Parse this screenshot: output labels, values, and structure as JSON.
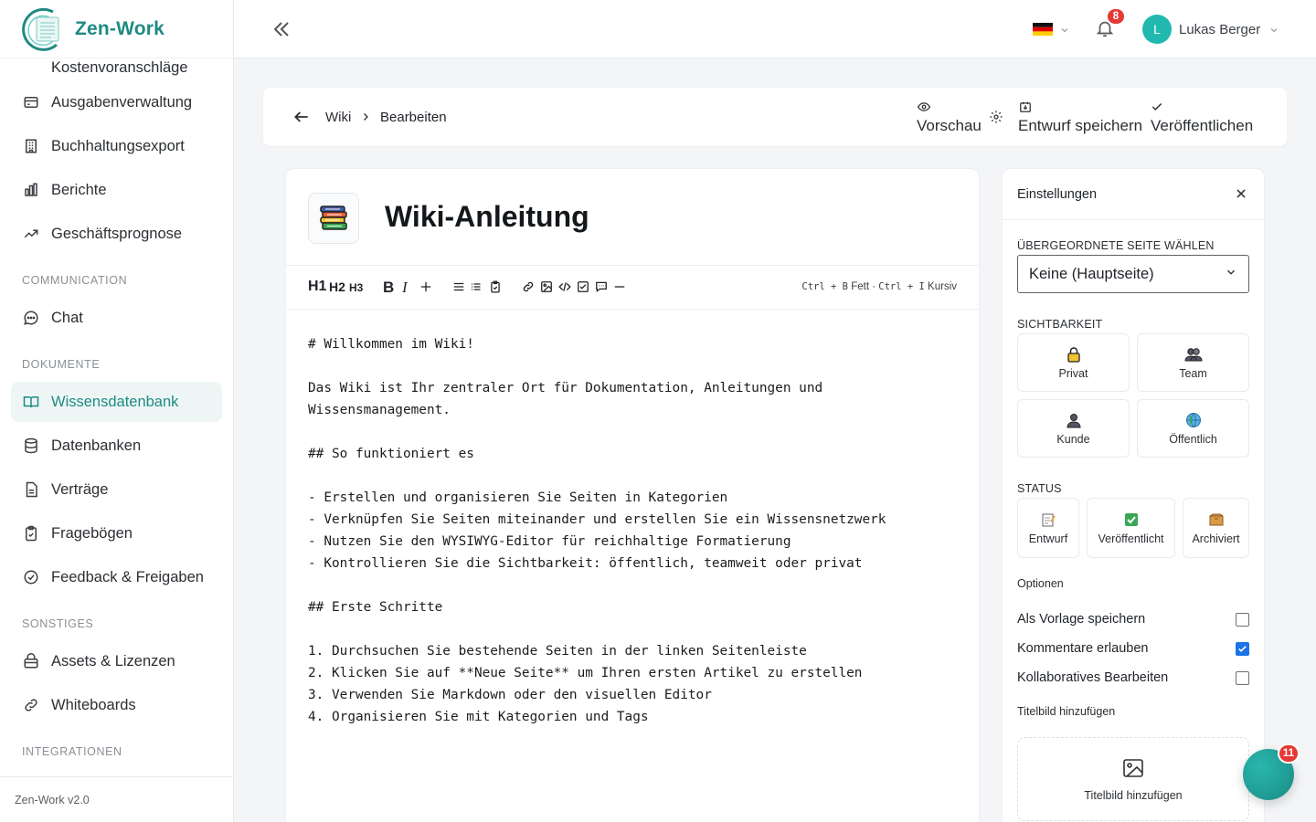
{
  "app": {
    "name": "Zen-Work",
    "version": "Zen-Work v2.0",
    "accent": "#1f8a83"
  },
  "sidebar": {
    "items": [
      {
        "label": "Kostenvoranschläge",
        "icon": "quote-icon"
      },
      {
        "label": "Ausgabenverwaltung",
        "icon": "wallet-icon"
      },
      {
        "label": "Buchhaltungsexport",
        "icon": "building-icon"
      },
      {
        "label": "Berichte",
        "icon": "bar-chart-icon"
      },
      {
        "label": "Geschäftsprognose",
        "icon": "trend-icon"
      }
    ],
    "sections": {
      "communication": "COMMUNICATION",
      "dokumente": "DOKUMENTE",
      "sonstiges": "SONSTIGES",
      "integrationen": "INTEGRATIONEN"
    },
    "communication_items": [
      {
        "label": "Chat",
        "icon": "chat-icon"
      }
    ],
    "dokumente_items": [
      {
        "label": "Wissensdatenbank",
        "icon": "book-icon",
        "active": true
      },
      {
        "label": "Datenbanken",
        "icon": "database-icon"
      },
      {
        "label": "Verträge",
        "icon": "document-icon"
      },
      {
        "label": "Fragebögen",
        "icon": "clipboard-icon"
      },
      {
        "label": "Feedback & Freigaben",
        "icon": "check-circle-icon"
      }
    ],
    "sonstiges_items": [
      {
        "label": "Assets & Lizenzen",
        "icon": "package-icon"
      },
      {
        "label": "Whiteboards",
        "icon": "link-icon"
      }
    ]
  },
  "topbar": {
    "language_flag": "de-flag-icon",
    "notifications_count": "8",
    "user_initial": "L",
    "user_name": "Lukas Berger"
  },
  "editbar": {
    "breadcrumb_root": "Wiki",
    "breadcrumb_current": "Bearbeiten",
    "preview_label": "Vorschau",
    "save_draft_label": "Entwurf speichern",
    "publish_label": "Veröffentlichen"
  },
  "editor": {
    "title": "Wiki-Anleitung",
    "toolbar": {
      "h1": "H1",
      "h2": "H2",
      "h3": "H3",
      "bold": "B",
      "italic": "I",
      "hint_bold_key": "Ctrl + B",
      "hint_bold": "Fett",
      "hint_italic_key": "Ctrl + I",
      "hint_italic": "Kursiv"
    },
    "content": "# Willkommen im Wiki!\n\nDas Wiki ist Ihr zentraler Ort für Dokumentation, Anleitungen und\nWissensmanagement.\n\n## So funktioniert es\n\n- Erstellen und organisieren Sie Seiten in Kategorien\n- Verknüpfen Sie Seiten miteinander und erstellen Sie ein Wissensnetzwerk\n- Nutzen Sie den WYSIWYG-Editor für reichhaltige Formatierung\n- Kontrollieren Sie die Sichtbarkeit: öffentlich, teamweit oder privat\n\n## Erste Schritte\n\n1. Durchsuchen Sie bestehende Seiten in der linken Seitenleiste\n2. Klicken Sie auf **Neue Seite** um Ihren ersten Artikel zu erstellen\n3. Verwenden Sie Markdown oder den visuellen Editor\n4. Organisieren Sie mit Kategorien und Tags"
  },
  "settings": {
    "title": "Einstellungen",
    "parent_label": "ÜBERGEORDNETE SEITE WÄHLEN",
    "parent_value": "Keine (Hauptseite)",
    "visibility_label": "SICHTBARKEIT",
    "visibility": {
      "private": "Privat",
      "team": "Team",
      "customer": "Kunde",
      "public": "Öffentlich"
    },
    "status_label": "STATUS",
    "status": {
      "draft": "Entwurf",
      "published": "Veröffentlicht",
      "archived": "Archiviert"
    },
    "options_label": "Optionen",
    "options": [
      {
        "label": "Als Vorlage speichern",
        "checked": false
      },
      {
        "label": "Kommentare erlauben",
        "checked": true
      },
      {
        "label": "Kollaboratives Bearbeiten",
        "checked": false
      }
    ],
    "cover_label": "Titelbild hinzufügen",
    "cover_button": "Titelbild hinzufügen"
  },
  "chat_bubble": {
    "badge": "11"
  }
}
